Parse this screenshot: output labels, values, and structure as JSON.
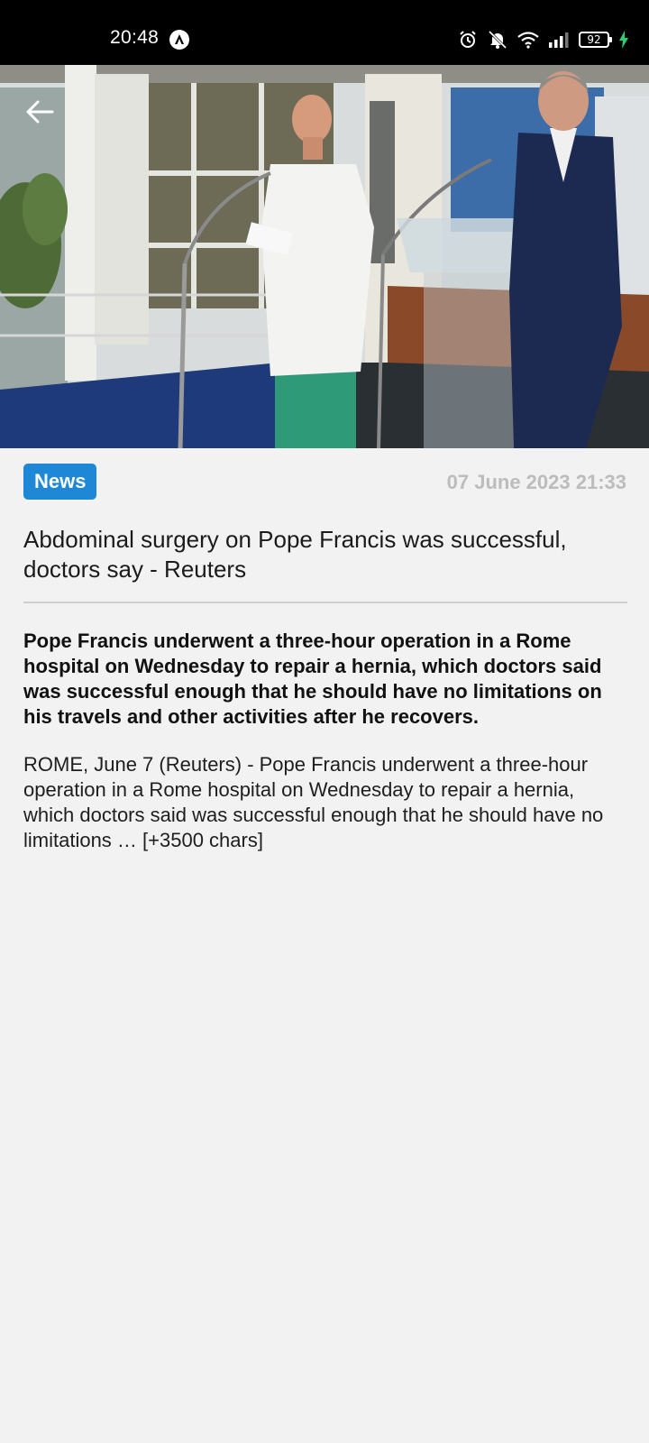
{
  "status_bar": {
    "time": "20:48",
    "battery_level": "92",
    "icons": [
      "alarm-icon",
      "mute-icon",
      "wifi-icon",
      "signal-icon",
      "battery-icon",
      "charging-icon"
    ]
  },
  "hero": {
    "image_description_icon": "photo",
    "back_icon": "arrow-left-icon"
  },
  "article": {
    "category": "News",
    "date": "07 June 2023 21:33",
    "title": "Abdominal surgery on Pope Francis was successful, doctors say - Reuters",
    "lead": "Pope Francis underwent a three-hour operation in a Rome hospital on Wednesday to repair a hernia, which doctors said was successful enough that he should have no limitations on his travels and other activities after he recovers.",
    "body": "ROME, June 7 (Reuters) - Pope Francis underwent a three-hour operation in a Rome hospital on Wednesday to repair a hernia, which doctors said was successful enough that he should have no limitations … [+3500 chars]"
  },
  "colors": {
    "badge": "#1e88d6",
    "background": "#f2f2f2",
    "date": "#bcbcbc"
  }
}
